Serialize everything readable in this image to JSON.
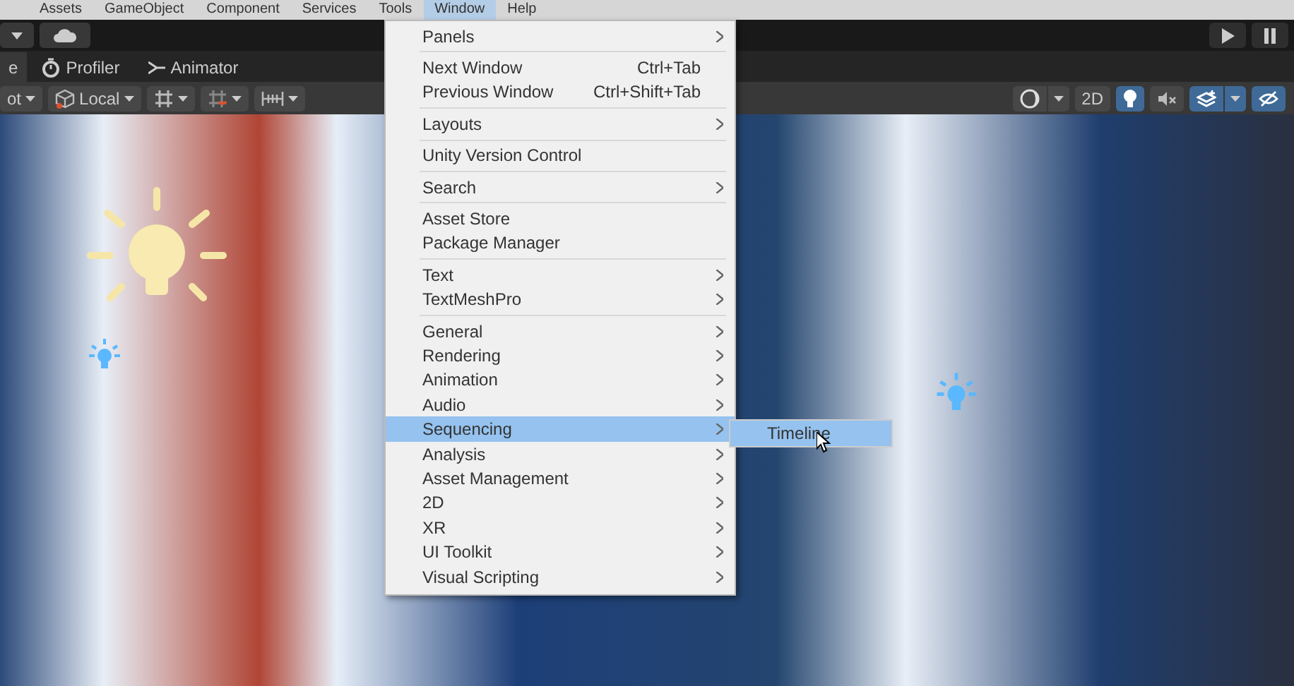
{
  "menubar": [
    {
      "label": "Assets",
      "selected": false
    },
    {
      "label": "GameObject",
      "selected": false
    },
    {
      "label": "Component",
      "selected": false
    },
    {
      "label": "Services",
      "selected": false
    },
    {
      "label": "Tools",
      "selected": false
    },
    {
      "label": "Window",
      "selected": true
    },
    {
      "label": "Help",
      "selected": false
    }
  ],
  "tabs": [
    {
      "label": "e",
      "selected": true
    },
    {
      "label": "Profiler",
      "selected": false
    },
    {
      "label": "Animator",
      "selected": false
    }
  ],
  "scene_toolbar_left": [
    {
      "label": "ot"
    },
    {
      "label": "Local"
    }
  ],
  "scene_toolbar_right": [
    {
      "on": false,
      "dropdown": true
    },
    {
      "label": "2D",
      "on": false,
      "dropdown": false
    },
    {
      "on": true,
      "dropdown": false
    },
    {
      "on": false,
      "dropdown": false
    },
    {
      "on": true,
      "dropdown": true
    },
    {
      "on": true,
      "dropdown": false
    }
  ],
  "window_menu": {
    "groups": [
      [
        {
          "label": "Panels",
          "submenu": true,
          "selected": false
        }
      ],
      [
        {
          "label": "Next Window",
          "shortcut": "Ctrl+Tab",
          "submenu": false,
          "selected": false
        },
        {
          "label": "Previous Window",
          "shortcut": "Ctrl+Shift+Tab",
          "submenu": false,
          "selected": false
        }
      ],
      [
        {
          "label": "Layouts",
          "submenu": true,
          "selected": false
        }
      ],
      [
        {
          "label": "Unity Version Control",
          "submenu": false,
          "selected": false
        }
      ],
      [
        {
          "label": "Search",
          "submenu": true,
          "selected": false
        }
      ],
      [
        {
          "label": "Asset Store",
          "submenu": false,
          "selected": false
        },
        {
          "label": "Package Manager",
          "submenu": false,
          "selected": false
        }
      ],
      [
        {
          "label": "Text",
          "submenu": true,
          "selected": false
        },
        {
          "label": "TextMeshPro",
          "submenu": true,
          "selected": false
        }
      ],
      [
        {
          "label": "General",
          "submenu": true,
          "selected": false
        },
        {
          "label": "Rendering",
          "submenu": true,
          "selected": false
        },
        {
          "label": "Animation",
          "submenu": true,
          "selected": false
        },
        {
          "label": "Audio",
          "submenu": true,
          "selected": false
        },
        {
          "label": "Sequencing",
          "submenu": true,
          "selected": true
        },
        {
          "label": "Analysis",
          "submenu": true,
          "selected": false
        },
        {
          "label": "Asset Management",
          "submenu": true,
          "selected": false
        },
        {
          "label": "2D",
          "submenu": true,
          "selected": false
        },
        {
          "label": "XR",
          "submenu": true,
          "selected": false
        },
        {
          "label": "UI Toolkit",
          "submenu": true,
          "selected": false
        },
        {
          "label": "Visual Scripting",
          "submenu": true,
          "selected": false
        }
      ]
    ]
  },
  "sequencing_submenu": [
    {
      "label": "Timeline",
      "selected": true
    }
  ]
}
